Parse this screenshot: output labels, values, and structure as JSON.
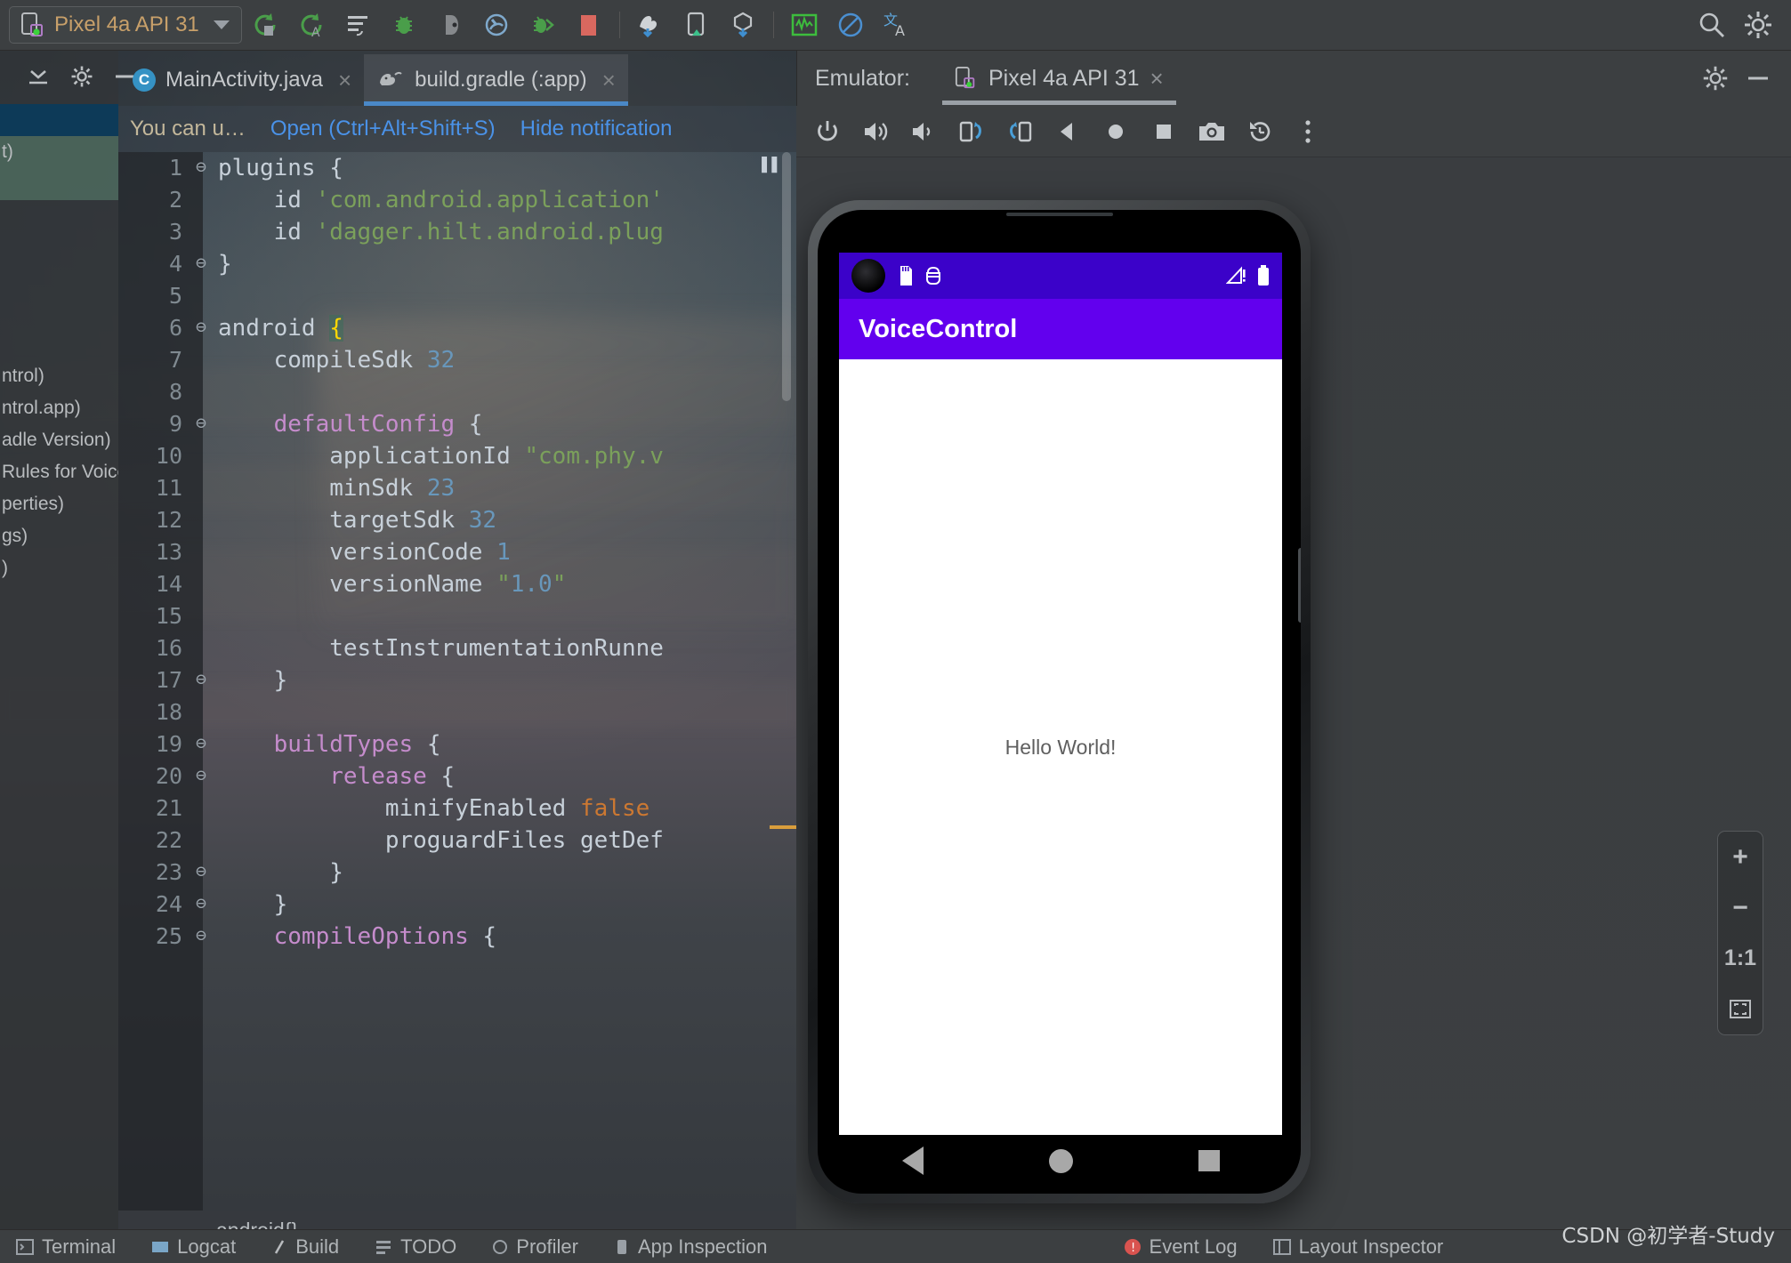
{
  "toolbar": {
    "device_selector": {
      "label": "Pixel 4a API 31",
      "icon": "device-phone-icon",
      "caret": "chevron-down-icon"
    },
    "buttons": [
      {
        "name": "rerun-icon",
        "title": "Rerun"
      },
      {
        "name": "rerun-all-icon",
        "title": "Rerun All"
      },
      {
        "name": "run-config-icon",
        "title": "Run Configurations"
      },
      {
        "name": "debug-icon",
        "title": "Debug"
      },
      {
        "name": "attach-debugger-icon",
        "title": "Attach Debugger"
      },
      {
        "name": "profiler-icon",
        "title": "Profiler"
      },
      {
        "name": "apply-changes-icon",
        "title": "Apply Changes"
      },
      {
        "name": "stop-icon",
        "title": "Stop"
      },
      {
        "name": "avd-manager-icon",
        "title": "AVD Manager"
      },
      {
        "name": "device-manager-icon",
        "title": "Device Manager"
      },
      {
        "name": "sdk-manager-icon",
        "title": "SDK Manager"
      },
      {
        "name": "layout-inspector-icon",
        "title": "Layout Inspector"
      },
      {
        "name": "no-entry-icon",
        "title": "Disabled"
      },
      {
        "name": "translate-icon",
        "title": "Translate"
      }
    ],
    "right_buttons": [
      {
        "name": "search-icon",
        "title": "Search Everywhere"
      },
      {
        "name": "settings-gear-icon",
        "title": "Settings"
      }
    ]
  },
  "left_panel": {
    "rows": [
      "t)",
      "",
      "",
      "",
      "ntrol)",
      "ntrol.app)",
      "adle Version)",
      " Rules for Voice",
      "perties)",
      "gs)",
      ")"
    ]
  },
  "editor": {
    "window_buttons": [
      {
        "name": "collapse-all-icon"
      },
      {
        "name": "settings-gear-icon"
      },
      {
        "name": "minimize-icon"
      }
    ],
    "tabs": [
      {
        "label": "MainActivity.java",
        "icon": "java-class-icon",
        "active": false,
        "close": "×"
      },
      {
        "label": "build.gradle (:app)",
        "icon": "gradle-elephant-icon",
        "active": true,
        "close": "×"
      }
    ],
    "notification": {
      "message": "You can u…",
      "action_open": "Open (Ctrl+Alt+Shift+S)",
      "action_hide": "Hide notification"
    },
    "breadcrumb": "android{}",
    "lines": [
      {
        "n": "1",
        "fold": "⊖",
        "html": "plugins {"
      },
      {
        "n": "2",
        "fold": "",
        "html": "    id 'com.android.application'"
      },
      {
        "n": "3",
        "fold": "",
        "html": "    id 'dagger.hilt.android.plug"
      },
      {
        "n": "4",
        "fold": "⊖",
        "html": "}"
      },
      {
        "n": "5",
        "fold": "",
        "html": ""
      },
      {
        "n": "6",
        "fold": "⊖",
        "html": "android {"
      },
      {
        "n": "7",
        "fold": "",
        "html": "    compileSdk 32"
      },
      {
        "n": "8",
        "fold": "",
        "html": ""
      },
      {
        "n": "9",
        "fold": "⊖",
        "html": "    defaultConfig {"
      },
      {
        "n": "10",
        "fold": "",
        "html": "        applicationId \"com.phy.v"
      },
      {
        "n": "11",
        "fold": "",
        "html": "        minSdk 23"
      },
      {
        "n": "12",
        "fold": "",
        "html": "        targetSdk 32"
      },
      {
        "n": "13",
        "fold": "",
        "html": "        versionCode 1"
      },
      {
        "n": "14",
        "fold": "",
        "html": "        versionName \"1.0\""
      },
      {
        "n": "15",
        "fold": "",
        "html": ""
      },
      {
        "n": "16",
        "fold": "",
        "html": "        testInstrumentationRunne"
      },
      {
        "n": "17",
        "fold": "⊖",
        "html": "    }"
      },
      {
        "n": "18",
        "fold": "",
        "html": ""
      },
      {
        "n": "19",
        "fold": "⊖",
        "html": "    buildTypes {"
      },
      {
        "n": "20",
        "fold": "⊖",
        "html": "        release {"
      },
      {
        "n": "21",
        "fold": "",
        "html": "            minifyEnabled false"
      },
      {
        "n": "22",
        "fold": "",
        "html": "            proguardFiles getDef"
      },
      {
        "n": "23",
        "fold": "⊖",
        "html": "        }"
      },
      {
        "n": "24",
        "fold": "⊖",
        "html": "    }"
      },
      {
        "n": "25",
        "fold": "⊖",
        "html": "    compileOptions {"
      }
    ]
  },
  "emulator": {
    "header_label": "Emulator:",
    "tab_label": "Pixel 4a API 31",
    "tab_icon": "device-phone-icon",
    "tab_close": "×",
    "header_buttons": [
      {
        "name": "settings-gear-icon"
      },
      {
        "name": "minimize-icon"
      }
    ],
    "controls": [
      {
        "name": "power-icon"
      },
      {
        "name": "volume-up-icon"
      },
      {
        "name": "volume-down-icon"
      },
      {
        "name": "rotate-left-icon"
      },
      {
        "name": "rotate-right-icon"
      },
      {
        "name": "back-icon"
      },
      {
        "name": "home-icon"
      },
      {
        "name": "overview-icon"
      },
      {
        "name": "screenshot-camera-icon"
      },
      {
        "name": "history-rollback-icon"
      },
      {
        "name": "more-vertical-icon"
      }
    ],
    "zoom_controls": [
      {
        "name": "zoom-in-button",
        "label": "+"
      },
      {
        "name": "zoom-out-button",
        "label": "−"
      },
      {
        "name": "zoom-actual-size-button",
        "label": "1:1"
      },
      {
        "name": "zoom-fit-button",
        "label": "fit-icon"
      }
    ],
    "device": {
      "status_bar": {
        "icons_left": [
          {
            "name": "sd-card-icon"
          },
          {
            "name": "android-debug-icon"
          }
        ],
        "icons_right": [
          {
            "name": "signal-warning-icon"
          },
          {
            "name": "battery-icon"
          }
        ],
        "bg_color": "#3b02c9"
      },
      "app_bar": {
        "title": "VoiceControl",
        "bg_color": "#6200ee"
      },
      "content": {
        "text": "Hello World!"
      },
      "nav_bar": {
        "buttons": [
          {
            "name": "nav-back-button"
          },
          {
            "name": "nav-home-button"
          },
          {
            "name": "nav-recents-button"
          }
        ]
      }
    }
  },
  "status_bar": {
    "items": [
      {
        "label": "Terminal",
        "icon": "terminal-icon"
      },
      {
        "label": "Logcat",
        "icon": "logcat-icon"
      },
      {
        "label": "Build",
        "icon": "build-icon"
      },
      {
        "label": "TODO",
        "icon": "todo-icon"
      },
      {
        "label": "Profiler",
        "icon": "profiler-icon"
      },
      {
        "label": "App Inspection",
        "icon": "inspection-icon"
      },
      {
        "label": "Event Log",
        "icon": "event-log-icon"
      },
      {
        "label": "Layout Inspector",
        "icon": "layout-inspector-icon"
      }
    ]
  },
  "watermark": "CSDN @初学者-Study"
}
